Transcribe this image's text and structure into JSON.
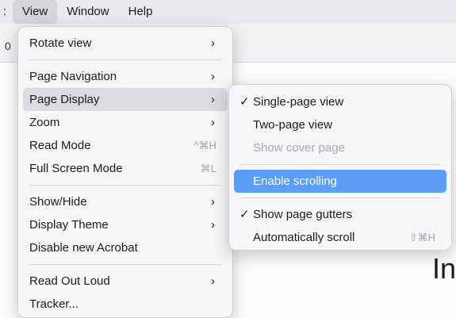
{
  "menubar": {
    "items": [
      {
        "label": ":"
      },
      {
        "label": "View"
      },
      {
        "label": "Window"
      },
      {
        "label": "Help"
      }
    ]
  },
  "background": {
    "toolbar_fragment": "0",
    "doc_text": "In"
  },
  "view_menu": {
    "rotate_view": {
      "label": "Rotate view",
      "chevron": "›"
    },
    "page_navigation": {
      "label": "Page Navigation",
      "chevron": "›"
    },
    "page_display": {
      "label": "Page Display",
      "chevron": "›"
    },
    "zoom": {
      "label": "Zoom",
      "chevron": "›"
    },
    "read_mode": {
      "label": "Read Mode",
      "shortcut": "^⌘H"
    },
    "full_screen_mode": {
      "label": "Full Screen Mode",
      "shortcut": "⌘L"
    },
    "show_hide": {
      "label": "Show/Hide",
      "chevron": "›"
    },
    "display_theme": {
      "label": "Display Theme",
      "chevron": "›"
    },
    "disable_new_acrobat": {
      "label": "Disable new Acrobat"
    },
    "read_out_loud": {
      "label": "Read Out Loud",
      "chevron": "›"
    },
    "tracker": {
      "label": "Tracker..."
    }
  },
  "page_display_menu": {
    "check_mark": "✓",
    "single_page_view": {
      "label": "Single-page view",
      "checked": true
    },
    "two_page_view": {
      "label": "Two-page view"
    },
    "show_cover_page": {
      "label": "Show cover page",
      "disabled": true
    },
    "enable_scrolling": {
      "label": "Enable scrolling",
      "highlighted": true
    },
    "show_page_gutters": {
      "label": "Show page gutters",
      "checked": true
    },
    "automatically_scroll": {
      "label": "Automatically scroll",
      "shortcut": "⇧⌘H"
    }
  },
  "colors": {
    "highlight_blue": "#5a9ef7",
    "hover_grey": "#dcdce0",
    "disabled_text": "#a8a8ad"
  }
}
